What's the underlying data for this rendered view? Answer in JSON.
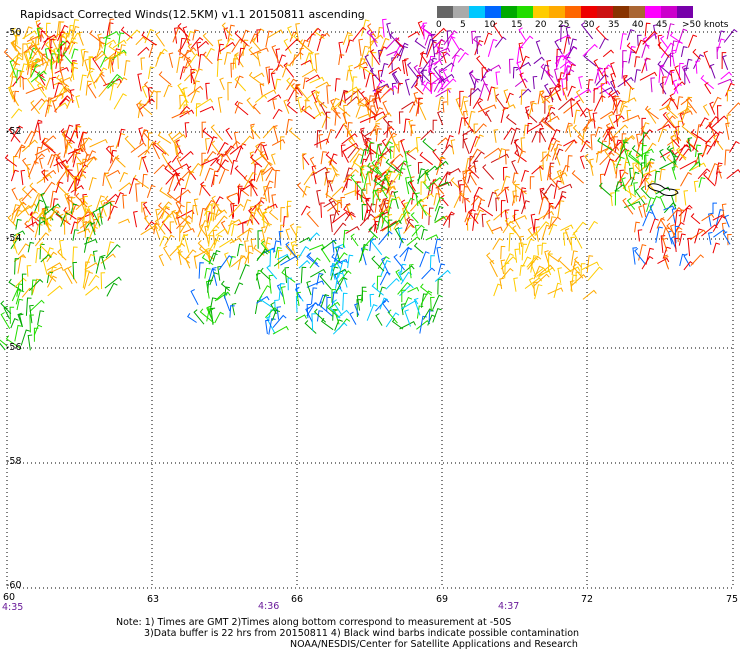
{
  "title": "Rapidsact Corrected Winds(12.5KM) v1.1 20150811 ascending",
  "legend": {
    "colors": [
      "#666666",
      "#aaaaaa",
      "#00c8ff",
      "#0066ff",
      "#00aa00",
      "#22dd00",
      "#ffcc00",
      "#ffaa00",
      "#ff6600",
      "#ee0000",
      "#cc1111",
      "#883300",
      "#aa6633",
      "#ff00ff",
      "#cc00cc",
      "#7700aa"
    ],
    "labels": [
      "0",
      "5",
      "10",
      "15",
      "20",
      "25",
      "30",
      "35",
      "40",
      "45",
      ">50 knots"
    ]
  },
  "axes": {
    "lat_labels": [
      "-50",
      "-52",
      "-54",
      "-56",
      "-58",
      "-60"
    ],
    "lon_labels": [
      "60",
      "63",
      "66",
      "69",
      "72",
      "75"
    ],
    "time_labels": [
      "4:35",
      "4:36",
      "4:37"
    ]
  },
  "notes": {
    "line1": "Note: 1) Times are GMT 2)Times along bottom correspond to measurement at -50S",
    "line2": "3)Data buffer is 22 hrs from 20150811 4) Black wind barbs indicate possible contamination",
    "line3": "NOAA/NESDIS/Center for Satellite Applications and Research"
  }
}
